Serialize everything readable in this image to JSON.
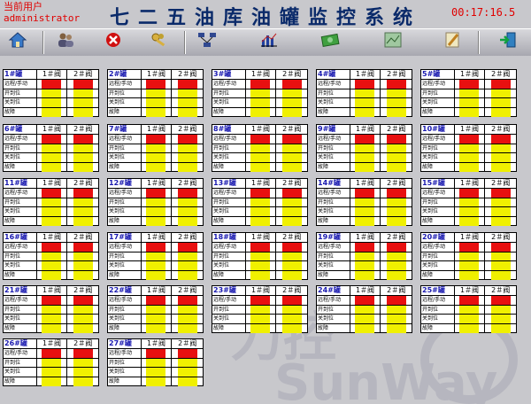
{
  "header": {
    "user_label": "当前用户",
    "user_name": "administrator",
    "title": "七二五油库油罐监控系统",
    "clock": "00:17:16.5"
  },
  "toolbar": {
    "buttons": [
      {
        "name": "home-icon"
      },
      {
        "name": "users-icon"
      },
      {
        "name": "close-icon"
      },
      {
        "name": "keys-icon"
      },
      {
        "name": "network-icon"
      },
      {
        "name": "chart-icon"
      },
      {
        "name": "money-icon"
      },
      {
        "name": "map-icon"
      },
      {
        "name": "pencil-icon"
      },
      {
        "name": "exit-icon"
      }
    ]
  },
  "tank_labels": {
    "valve1": "1＃阀",
    "valve2": "2＃阀",
    "rows": [
      "远程/手动",
      "开到位",
      "关到位",
      "故障"
    ]
  },
  "tanks": [
    {
      "name": "1#罐"
    },
    {
      "name": "2#罐"
    },
    {
      "name": "3#罐"
    },
    {
      "name": "4#罐"
    },
    {
      "name": "5#罐"
    },
    {
      "name": "6#罐"
    },
    {
      "name": "7#罐"
    },
    {
      "name": "8#罐"
    },
    {
      "name": "9#罐"
    },
    {
      "name": "10#罐"
    },
    {
      "name": "11#罐"
    },
    {
      "name": "12#罐"
    },
    {
      "name": "13#罐"
    },
    {
      "name": "14#罐"
    },
    {
      "name": "15#罐"
    },
    {
      "name": "16#罐"
    },
    {
      "name": "17#罐"
    },
    {
      "name": "18#罐"
    },
    {
      "name": "19#罐"
    },
    {
      "name": "20#罐"
    },
    {
      "name": "21#罐"
    },
    {
      "name": "22#罐"
    },
    {
      "name": "23#罐"
    },
    {
      "name": "24#罐"
    },
    {
      "name": "25#罐"
    },
    {
      "name": "26#罐"
    },
    {
      "name": "27#罐"
    }
  ],
  "indicator_states": [
    "red",
    "yellow",
    "yellow",
    "yellow"
  ],
  "colors": {
    "red": "#e81010",
    "yellow": "#f0f000",
    "title": "#0a2a6a",
    "clock": "#e00000"
  }
}
